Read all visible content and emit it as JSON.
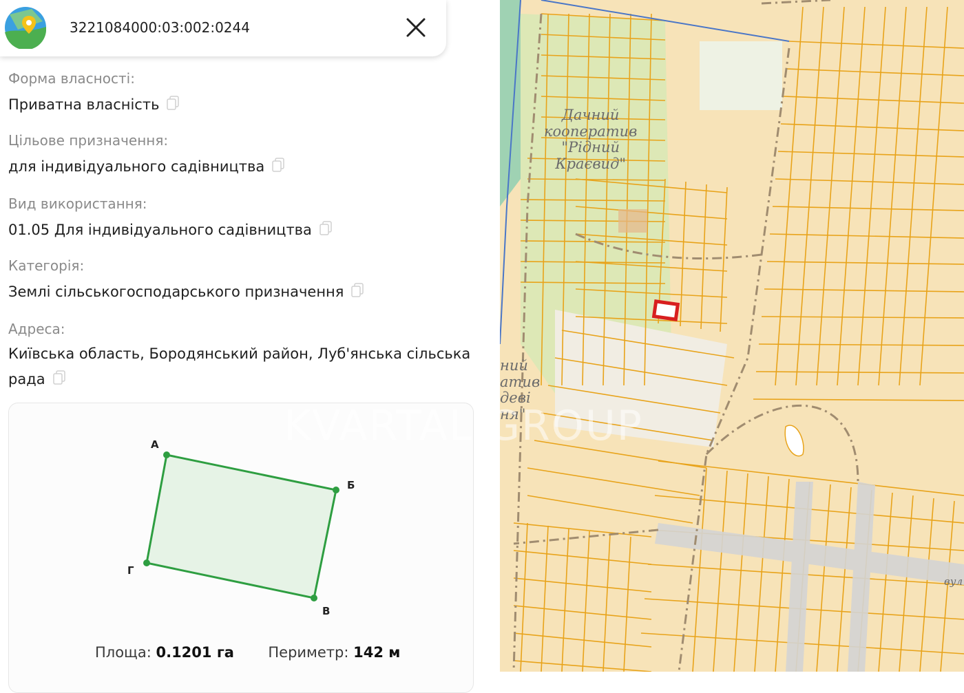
{
  "parcel": {
    "cadastral_number": "3221084000:03:002:0244"
  },
  "fields": [
    {
      "label": "Форма власності:",
      "value": "Приватна власність"
    },
    {
      "label": "Цільове призначення:",
      "value": "для індивідуального садівництва"
    },
    {
      "label": "Вид використання:",
      "value": "01.05 Для індивідуального садівництва"
    },
    {
      "label": "Категорія:",
      "value": "Землі сільськогосподарського призначення"
    },
    {
      "label": "Адреса:",
      "value_line1": "Київська область, Бородянський район, Луб'янська сільська",
      "value_line2": "рада"
    }
  ],
  "plot": {
    "vertices": [
      {
        "label": "А"
      },
      {
        "label": "Б"
      },
      {
        "label": "В"
      },
      {
        "label": "Г"
      }
    ],
    "area_label": "Площа:",
    "area_value": "0.1201 га",
    "perimeter_label": "Периметр:",
    "perimeter_value": "142 м"
  },
  "map": {
    "cooperative_label_line1": "Дачний",
    "cooperative_label_line2": "кооператив",
    "cooperative_label_line3": "\"Рідний",
    "cooperative_label_line4": "Краєвид\"",
    "left_label_line1": "ний",
    "left_label_line2": "атив",
    "left_label_line3": "деві",
    "left_label_line4": "ня\"",
    "street_label": "вул",
    "watermark": "KVARTAL GROUP"
  },
  "colors": {
    "parcel_fill": "#f7e3b8",
    "parcel_border": "#e8a31a",
    "forest": "#cfe8c4",
    "highlight": "#d81f1f",
    "plot_stroke": "#2e9e41",
    "plot_fill": "#e6f3e6"
  }
}
